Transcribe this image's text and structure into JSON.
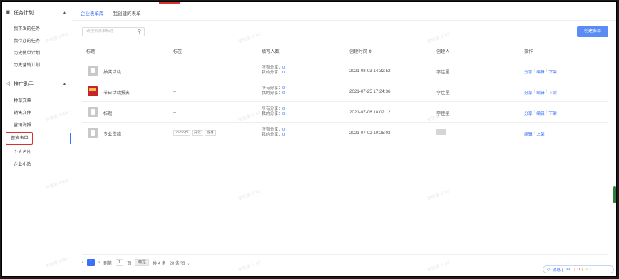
{
  "sidebar": {
    "section1": {
      "label": "任务计划",
      "icon": "calendar-icon"
    },
    "section1_items": [
      "我下发的任务",
      "我待办的任务",
      "历史做单计划",
      "历史营销计划"
    ],
    "section2": {
      "label": "推广助手",
      "icon": "megaphone-icon"
    },
    "section2_items": [
      "种草文章",
      "销售文件",
      "营销海报",
      "留资表单",
      "个人名片",
      "企业小站"
    ]
  },
  "tabs": [
    "企业表单库",
    "我创建的表单"
  ],
  "search": {
    "placeholder": "请搜索表单标题"
  },
  "create_button": "创建表单",
  "table": {
    "headers": [
      "标题",
      "标签",
      "填写人数",
      "创建时间",
      "创建人",
      "操作"
    ],
    "sort_icon": "⇕",
    "rows": [
      {
        "title": "抽奖活动",
        "tags": "--",
        "share_all": "所有分享：",
        "share_all_n": "0",
        "share_mine": "我的分享：",
        "share_mine_n": "0",
        "time": "2021-08-03 14:32:52",
        "creator": "李佳星",
        "ops": [
          "分享",
          "编辑",
          "下架"
        ]
      },
      {
        "title": "节日活动报名",
        "tags": "--",
        "share_all": "所有分享：",
        "share_all_n": "0",
        "share_mine": "我的分享：",
        "share_mine_n": "0",
        "time": "2021-07-25 17:24:36",
        "creator": "李佳星",
        "ops": [
          "分享",
          "编辑",
          "下架"
        ]
      },
      {
        "title": "标题",
        "tags": "--",
        "share_all": "所有分享：",
        "share_all_n": "0",
        "share_mine": "我的分享：",
        "share_mine_n": "0",
        "time": "2021-07-06 18:02:12",
        "creator": "李佳星",
        "ops": [
          "分享",
          "编辑",
          "下架"
        ]
      },
      {
        "title": "专业贷款",
        "tag_list": [
          "25-55岁",
          "贷款",
          "成家"
        ],
        "share_all": "所有分享：",
        "share_all_n": "0",
        "share_mine": "我的分享：",
        "share_mine_n": "0",
        "time": "2021-07-02 10:25:03",
        "creator": "",
        "ops": [
          "编辑",
          "上架"
        ]
      }
    ]
  },
  "pager": {
    "prev": "‹",
    "page": "1",
    "next": "›",
    "goto": "到第",
    "page_input": "1",
    "page_unit": "页",
    "confirm": "确定",
    "total": "共 4 条",
    "size": "20 条/页"
  },
  "msgbar": {
    "label": "消息 (",
    "n1": "99⁺",
    "n2": "0",
    "n3": "0",
    "close": ")"
  },
  "watermark": "李佳星 4763",
  "colors": {
    "accent": "#3a6ff7",
    "highlight": "#d9322e",
    "create_btn": "#5b8cf5"
  }
}
